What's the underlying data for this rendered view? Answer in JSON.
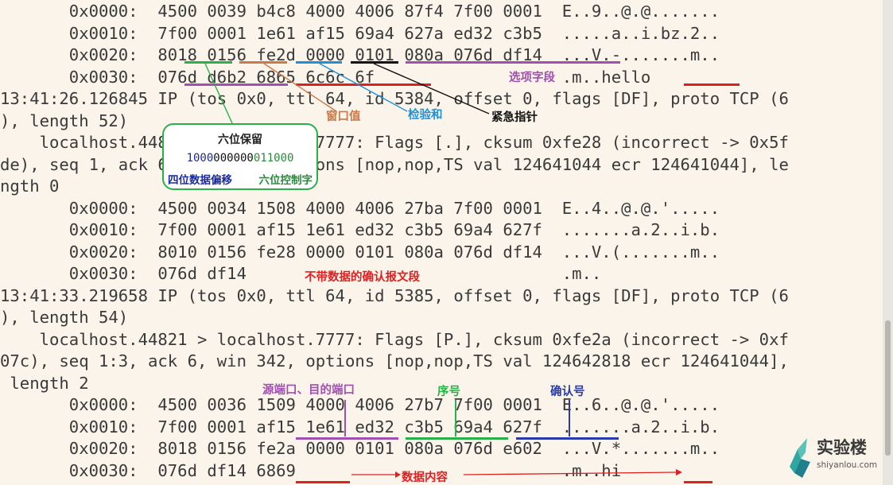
{
  "terminal": {
    "lines": [
      "       0x0000:  4500 0039 b4c8 4000 4006 87f4 7f00 0001  E..9..@.@.......",
      "       0x0010:  7f00 0001 1e61 af15 69a4 627a ed32 c3b5  .....a..i.bz.2..",
      "       0x0020:  8018 0156 fe2d 0000 0101 080a 076d df14  ...V.-.......m..",
      "       0x0030:  076d d6b2 6865 6c6c 6f                   .m..hello",
      "13:41:26.126845 IP (tos 0x0, ttl 64, id 5384, offset 0, flags [DF], proto TCP (6",
      "), length 52)",
      "    localhost.44821 > localhost.7777: Flags [.], cksum 0xfe28 (incorrect -> 0x5f",
      "de), seq 1, ack 6, win 342, options [nop,nop,TS val 124641044 ecr 124641044], le",
      "ngth 0",
      "       0x0000:  4500 0034 1508 4000 4006 27ba 7f00 0001  E..4..@.@.'.....",
      "       0x0010:  7f00 0001 af15 1e61 ed32 c3b5 69a4 627f  .......a.2..i.b.",
      "       0x0020:  8010 0156 fe28 0000 0101 080a 076d df14  ...V.(.......m..",
      "       0x0030:  076d df14                                .m..",
      "13:41:33.219658 IP (tos 0x0, ttl 64, id 5385, offset 0, flags [DF], proto TCP (6",
      "), length 54)",
      "    localhost.44821 > localhost.7777: Flags [P.], cksum 0xfe2a (incorrect -> 0xf",
      "07c), seq 1:3, ack 6, win 342, options [nop,nop,TS val 124642818 ecr 124641044],",
      " length 2",
      "       0x0000:  4500 0036 1509 4000 4006 27b7 7f00 0001  E..6..@.@.'.....",
      "       0x0010:  7f00 0001 af15 1e61 ed32 c3b5 69a4 627f  .......a.2..i.b.",
      "       0x0020:  8018 0156 fe2a 0000 0101 080a 076d e602  ...V.*.......m..",
      "       0x0030:  076d df14 6869                           .m..hi"
    ]
  },
  "annotations": {
    "options_field": "选项字段",
    "window_value": "窗口值",
    "checksum": "检验和",
    "urgent_pointer": "紧急指针",
    "ack_no_data": "不带数据的确认报文段",
    "ports": "源端口、目的端口",
    "seq": "序号",
    "ack_number": "确认号",
    "data_content": "数据内容"
  },
  "callout": {
    "title": "六位保留",
    "bits_offset": "1000",
    "bits_reserved": "000000",
    "bits_flags": "011000",
    "left_label": "四位数据偏移",
    "right_label": "六位控制字"
  },
  "logo": {
    "name": "实验楼",
    "url_text": "shiyanlou.com"
  },
  "colors": {
    "background": "#fbf4ea",
    "terminal_text": "#3a3a3a",
    "green": "#2ab04a",
    "brown": "#c87a4a",
    "blue": "#1e90d8",
    "black": "#111111",
    "purple": "#a050b0",
    "red": "#e02020",
    "navy": "#2a3aa8"
  }
}
